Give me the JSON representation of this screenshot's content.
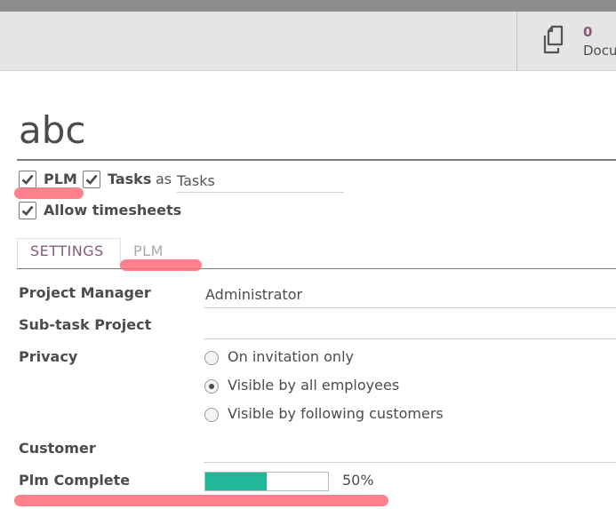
{
  "header": {
    "documents_count": "0",
    "documents_label": "Docu"
  },
  "record": {
    "title": "abc"
  },
  "options": {
    "plm_label": "PLM",
    "tasks_label": "Tasks",
    "as_label": "as",
    "tasks_alias_value": "Tasks",
    "allow_timesheets_label": "Allow timesheets"
  },
  "tabs": [
    {
      "label": "SETTINGS"
    },
    {
      "label": "PLM"
    }
  ],
  "fields": {
    "project_manager_label": "Project Manager",
    "project_manager_value": "Administrator",
    "subtask_label": "Sub-task Project",
    "privacy_label": "Privacy",
    "privacy_options": [
      {
        "label": "On invitation only",
        "checked": false
      },
      {
        "label": "Visible by all employees",
        "checked": true
      },
      {
        "label": "Visible by following customers",
        "checked": false
      }
    ],
    "customer_label": "Customer",
    "plm_complete_label": "Plm Complete",
    "plm_complete_value": 50,
    "plm_complete_text": "50%"
  },
  "colors": {
    "accent": "#875a7b",
    "progress": "#21b799",
    "highlight": "#ff6b7a"
  }
}
